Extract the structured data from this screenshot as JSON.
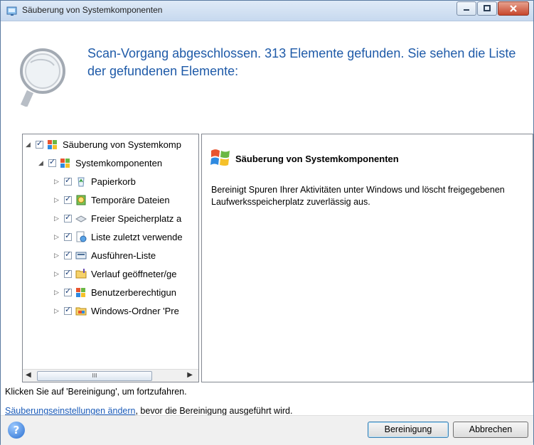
{
  "window": {
    "title": "Säuberung von Systemkomponenten",
    "icon": "cleanup-app-icon"
  },
  "header": {
    "message": "Scan-Vorgang abgeschlossen. 313 Elemente gefunden. Sie sehen die Liste der gefundenen Elemente:"
  },
  "tree": {
    "root_label": "Säuberung von Systemkomp",
    "child_label": "Systemkomponenten",
    "items": [
      {
        "label": "Papierkorb",
        "icon": "recycle-bin-icon",
        "checked": true
      },
      {
        "label": "Temporäre Dateien",
        "icon": "temp-files-icon",
        "checked": true
      },
      {
        "label": "Freier Speicherplatz a",
        "icon": "disk-free-space-icon",
        "checked": true
      },
      {
        "label": "Liste zuletzt verwende",
        "icon": "recent-list-icon",
        "checked": true
      },
      {
        "label": "Ausführen-Liste",
        "icon": "run-list-icon",
        "checked": true
      },
      {
        "label": "Verlauf geöffneter/ge",
        "icon": "folder-history-icon",
        "checked": true
      },
      {
        "label": "Benutzerberechtigun",
        "icon": "user-rights-icon",
        "checked": true
      },
      {
        "label": "Windows-Ordner 'Pre",
        "icon": "prefetch-folder-icon",
        "checked": true
      }
    ],
    "scroll_thumb_label": "III"
  },
  "detail": {
    "title": "Säuberung von Systemkomponenten",
    "description": "Bereinigt Spuren Ihrer Aktivitäten unter Windows und löscht freigegebenen Laufwerksspeicherplatz zuverlässig aus."
  },
  "footer": {
    "hint": "Klicken Sie auf 'Bereinigung', um fortzufahren.",
    "settings_link": "Säuberungseinstellungen ändern",
    "settings_suffix": ", bevor die Bereinigung ausgeführt wird."
  },
  "buttons": {
    "clean": "Bereinigung",
    "cancel": "Abbrechen"
  }
}
